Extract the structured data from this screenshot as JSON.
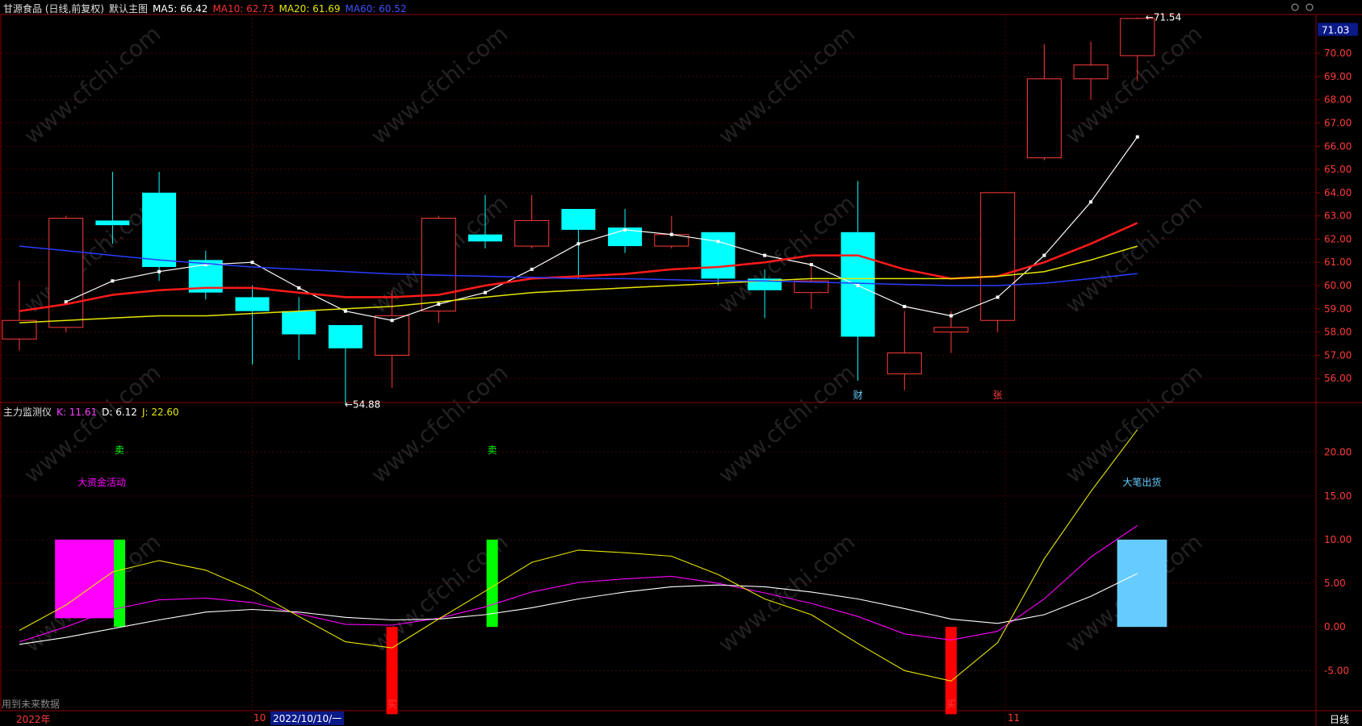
{
  "price_header": {
    "stock_title": "甘源食品 (日线,前复权)",
    "main_chart_label": "默认主图",
    "ma5": "MA5: 66.42",
    "ma10": "MA10: 62.73",
    "ma20": "MA20: 61.69",
    "ma60": "MA60: 60.52"
  },
  "indicator_header": {
    "name": "主力监测仪",
    "k": "K: 11.61",
    "d": "D: 6.12",
    "j": "J: 22.60"
  },
  "colors": {
    "up": "#ff3b3b",
    "down": "#00ffff",
    "ma5": "#ffffff",
    "ma10": "#ff1a1a",
    "ma20": "#e6e600",
    "ma60": "#2a3cff",
    "grid": "#4a0000",
    "axis": "#8a0000",
    "sell": "#00ff00",
    "buy": "#ff0000",
    "fund": "#ff00ff",
    "dump": "#66ccff"
  },
  "chart_data": [
    {
      "type": "candlestick",
      "ylim": [
        55,
        71.6
      ],
      "y_ticks": [
        "56.00",
        "57.00",
        "58.00",
        "59.00",
        "60.00",
        "61.00",
        "62.00",
        "63.00",
        "64.00",
        "65.00",
        "66.00",
        "67.00",
        "68.00",
        "69.00",
        "70.00"
      ],
      "current_price_tag": "71.03",
      "max_label": "71.54",
      "min_label": "54.88",
      "candles": [
        {
          "o": 57.7,
          "h": 60.2,
          "l": 57.2,
          "c": 58.5
        },
        {
          "o": 58.2,
          "h": 63.0,
          "l": 58.0,
          "c": 62.9
        },
        {
          "o": 62.8,
          "h": 64.9,
          "l": 61.8,
          "c": 62.6
        },
        {
          "o": 64.0,
          "h": 64.9,
          "l": 60.2,
          "c": 60.8
        },
        {
          "o": 61.1,
          "h": 61.5,
          "l": 59.4,
          "c": 59.7
        },
        {
          "o": 59.5,
          "h": 60.0,
          "l": 56.6,
          "c": 58.9
        },
        {
          "o": 58.9,
          "h": 59.5,
          "l": 56.8,
          "c": 57.9
        },
        {
          "o": 58.3,
          "h": 58.3,
          "l": 54.88,
          "c": 57.3
        },
        {
          "o": 57.0,
          "h": 59.8,
          "l": 55.6,
          "c": 58.7
        },
        {
          "o": 58.9,
          "h": 63.0,
          "l": 58.4,
          "c": 62.9
        },
        {
          "o": 62.2,
          "h": 63.9,
          "l": 61.6,
          "c": 61.9
        },
        {
          "o": 61.7,
          "h": 63.9,
          "l": 61.6,
          "c": 62.8
        },
        {
          "o": 63.3,
          "h": 63.3,
          "l": 60.3,
          "c": 62.4
        },
        {
          "o": 62.5,
          "h": 63.3,
          "l": 61.4,
          "c": 61.7
        },
        {
          "o": 61.7,
          "h": 63.0,
          "l": 61.6,
          "c": 62.2
        },
        {
          "o": 62.3,
          "h": 62.3,
          "l": 60.0,
          "c": 60.3
        },
        {
          "o": 60.3,
          "h": 60.7,
          "l": 58.6,
          "c": 59.8
        },
        {
          "o": 59.7,
          "h": 60.8,
          "l": 59.0,
          "c": 60.2
        },
        {
          "o": 62.3,
          "h": 64.5,
          "l": 55.9,
          "c": 57.8
        },
        {
          "o": 56.2,
          "h": 58.9,
          "l": 55.5,
          "c": 57.1
        },
        {
          "o": 58.0,
          "h": 58.9,
          "l": 57.1,
          "c": 58.2
        },
        {
          "o": 58.5,
          "h": 58.5,
          "l": 58.0,
          "c": 64.0
        },
        {
          "o": 65.5,
          "h": 70.4,
          "l": 65.4,
          "c": 68.9
        },
        {
          "o": 68.9,
          "h": 70.5,
          "l": 68.0,
          "c": 69.5
        },
        {
          "o": 69.9,
          "h": 71.54,
          "l": 68.8,
          "c": 71.5
        }
      ],
      "series": [
        {
          "name": "MA5",
          "values": [
            null,
            59.3,
            60.2,
            60.6,
            60.9,
            61.0,
            59.9,
            58.9,
            58.5,
            59.2,
            59.7,
            60.7,
            61.8,
            62.4,
            62.2,
            61.9,
            61.3,
            60.9,
            60.0,
            59.1,
            58.7,
            59.5,
            61.3,
            63.6,
            66.4
          ]
        },
        {
          "name": "MA10",
          "values": [
            58.9,
            59.2,
            59.6,
            59.8,
            59.9,
            59.9,
            59.7,
            59.5,
            59.5,
            59.6,
            60.0,
            60.3,
            60.4,
            60.5,
            60.7,
            60.8,
            61.0,
            61.3,
            61.3,
            60.7,
            60.3,
            60.4,
            61.0,
            61.8,
            62.7
          ]
        },
        {
          "name": "MA20",
          "values": [
            58.4,
            58.5,
            58.6,
            58.7,
            58.7,
            58.8,
            58.9,
            59.0,
            59.1,
            59.3,
            59.5,
            59.7,
            59.8,
            59.9,
            60.0,
            60.1,
            60.2,
            60.3,
            60.3,
            60.3,
            60.3,
            60.4,
            60.6,
            61.1,
            61.7
          ]
        },
        {
          "name": "MA60",
          "values": [
            61.7,
            61.5,
            61.3,
            61.1,
            60.95,
            60.8,
            60.7,
            60.6,
            60.5,
            60.45,
            60.4,
            60.35,
            60.3,
            60.3,
            60.25,
            60.2,
            60.2,
            60.15,
            60.1,
            60.05,
            60.0,
            60.0,
            60.1,
            60.3,
            60.52
          ]
        }
      ],
      "markers": [
        {
          "index": 18,
          "text": "财"
        },
        {
          "index": 21,
          "text": "张"
        }
      ]
    },
    {
      "type": "line",
      "ylim": [
        -9.5,
        24.5
      ],
      "y_ticks": [
        "-5.00",
        "0.00",
        "5.00",
        "10.00",
        "15.00",
        "20.00"
      ],
      "series": [
        {
          "name": "K",
          "values": [
            -1.7,
            0.0,
            2.0,
            3.1,
            3.3,
            2.8,
            1.5,
            0.3,
            0.2,
            1.0,
            2.3,
            4.0,
            5.1,
            5.5,
            5.8,
            5.0,
            3.9,
            2.7,
            1.2,
            -0.8,
            -1.5,
            -0.5,
            3.2,
            8.0,
            11.61
          ]
        },
        {
          "name": "D",
          "values": [
            -2.0,
            -1.2,
            -0.2,
            0.8,
            1.7,
            2.0,
            1.7,
            1.1,
            0.8,
            0.9,
            1.4,
            2.2,
            3.2,
            4.0,
            4.6,
            4.8,
            4.6,
            4.0,
            3.2,
            2.1,
            0.9,
            0.4,
            1.4,
            3.5,
            6.12
          ]
        },
        {
          "name": "J",
          "values": [
            -0.4,
            2.5,
            6.3,
            7.6,
            6.5,
            4.2,
            1.2,
            -1.7,
            -2.4,
            0.9,
            4.1,
            7.4,
            8.8,
            8.5,
            8.1,
            6.0,
            3.2,
            1.4,
            -1.9,
            -5.0,
            -6.2,
            -1.8,
            7.8,
            15.5,
            22.6
          ]
        }
      ],
      "signals": [
        {
          "type": "fund",
          "label": "大资金活动",
          "x_from": 0.8,
          "x_to": 2.0,
          "y_from": 1.0,
          "y_to": 10.0
        },
        {
          "type": "sell",
          "label": "卖",
          "index": 2.15,
          "y_from": 0.0,
          "y_to": 10.0
        },
        {
          "type": "sell",
          "label": "卖",
          "index": 10.15,
          "y_from": 0.0,
          "y_to": 10.0
        },
        {
          "type": "buy",
          "label": "买",
          "index": 8.0,
          "y_from": 0.0,
          "y_to": -10.0
        },
        {
          "type": "buy",
          "label": "买",
          "index": 20.0,
          "y_from": 0.0,
          "y_to": -10.0
        },
        {
          "type": "dump",
          "label": "大笔出货",
          "x_from": 23.6,
          "x_to": 24.6,
          "y_from": 0.0,
          "y_to": 10.0
        }
      ]
    }
  ],
  "bottom_bar": {
    "future_data_note": "用到未来数据",
    "year_label": "2022年",
    "month_oct": "10",
    "cursor_date": "2022/10/10/一",
    "month_nov": "11",
    "period_label": "日线"
  }
}
